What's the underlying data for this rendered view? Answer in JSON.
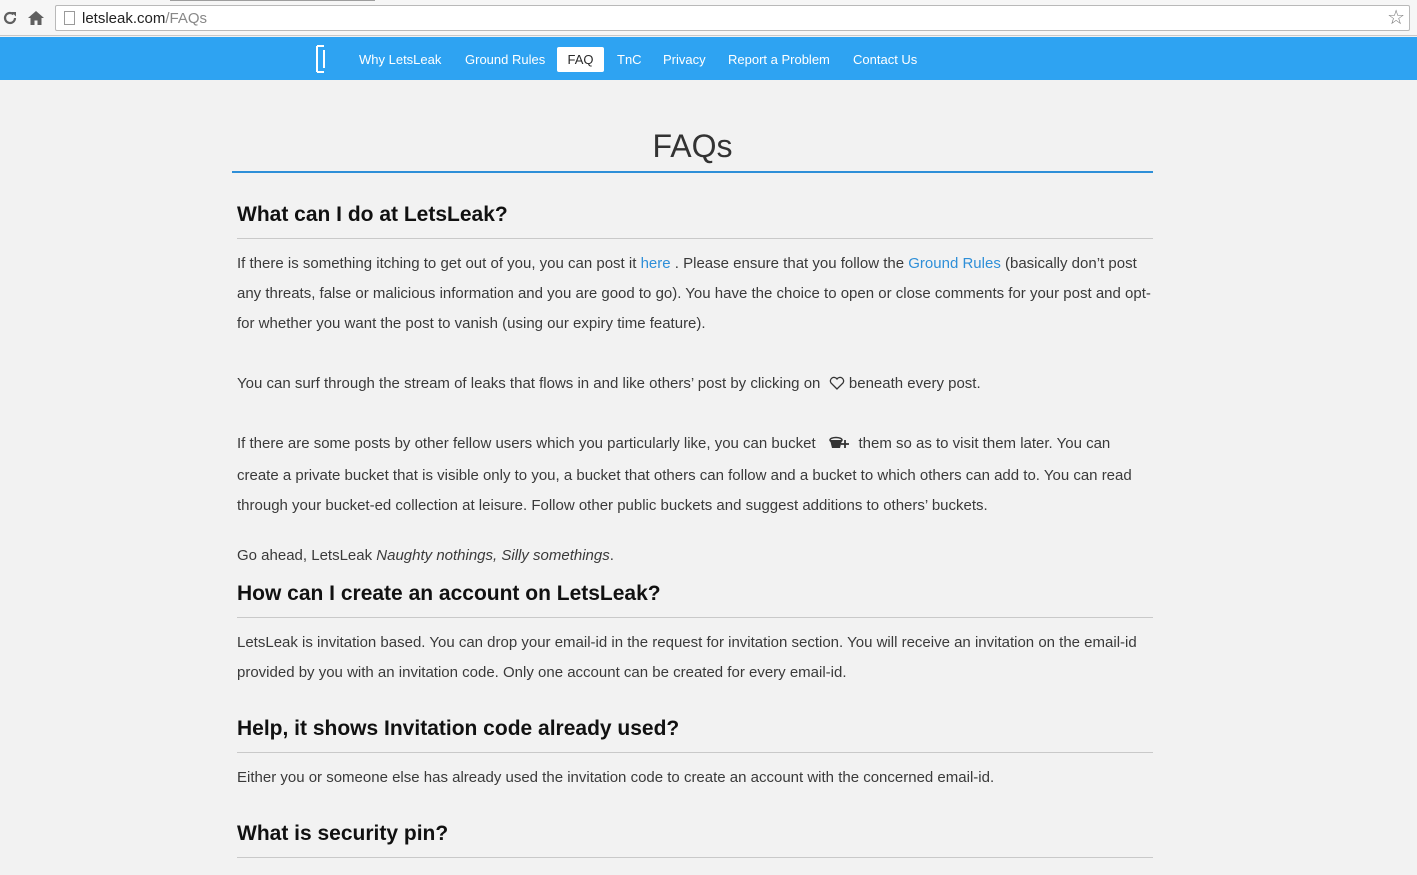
{
  "browser": {
    "url_host": "letsleak.com",
    "url_path": "/FAQs"
  },
  "nav": {
    "items": [
      {
        "label": "Why LetsLeak"
      },
      {
        "label": "Ground Rules"
      },
      {
        "label": "FAQ"
      },
      {
        "label": "TnC"
      },
      {
        "label": "Privacy"
      },
      {
        "label": "Report a Problem"
      },
      {
        "label": "Contact Us"
      }
    ],
    "active": "FAQ"
  },
  "page": {
    "title": "FAQs"
  },
  "faq": {
    "q1": {
      "heading": "What can I do at LetsLeak?",
      "p1_a": "If there is something itching to get out of you, you can post it",
      "p1_link1": "here",
      "p1_b": ". Please ensure that you follow the",
      "p1_link2": "Ground Rules",
      "p1_c": "(basically don’t post any threats, false or malicious information and you are good to go). You have the choice to open or close comments for your post and opt-for whether you want the post to vanish (using our expiry time feature).",
      "p2_a": "You can surf through the stream of leaks that flows in and like others’ post by clicking on",
      "p2_b": "beneath every post.",
      "p3_a": "If there are some posts by other fellow users which you particularly like, you can bucket",
      "p3_b": "them so as to visit them later. You can create a private bucket that is visible only to you, a bucket that others can follow and a bucket to which others can add to. You can read through your bucket-ed collection at leisure. Follow other public buckets and suggest additions to others’ buckets.",
      "p4_a": "Go ahead, LetsLeak",
      "p4_em": "Naughty nothings, Silly somethings",
      "p4_b": "."
    },
    "q2": {
      "heading": "How can I create an account on LetsLeak?",
      "p1": "LetsLeak is invitation based. You can drop your email-id in the request for invitation section. You will receive an invitation on the email-id provided by you with an invitation code. Only one account can be created for every email-id."
    },
    "q3": {
      "heading": "Help, it shows Invitation code already used?",
      "p1": "Either you or someone else has already used the invitation code to create an account with the concerned email-id."
    },
    "q4": {
      "heading": "What is security pin?"
    }
  },
  "colors": {
    "nav_bg": "#2ea3f2",
    "link": "#2e8fd8",
    "page_bg": "#f2f2f2"
  },
  "icons": [
    "reload-icon",
    "home-icon",
    "page-icon",
    "star-icon",
    "logo-icon",
    "heart-icon",
    "bucket-add-icon"
  ]
}
